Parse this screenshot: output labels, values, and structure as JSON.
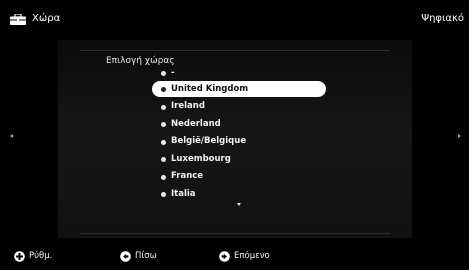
{
  "header": {
    "title": "Χώρα",
    "mode": "Ψηφιακό",
    "icon": "toolbox-icon"
  },
  "country_list": {
    "label": "Επιλογή χώρας",
    "placeholder": "-",
    "items": [
      "United Kingdom",
      "Ireland",
      "Nederland",
      "België/Belgique",
      "Luxembourg",
      "France",
      "Italia"
    ],
    "selected": "United Kingdom"
  },
  "footer": {
    "settings_label": "Ρύθμ.",
    "back_label": "Πίσω",
    "next_label": "Επόμενο"
  },
  "colors": {
    "background": "#000000",
    "selected_bg": "#ffffff",
    "text": "#ffffff"
  }
}
